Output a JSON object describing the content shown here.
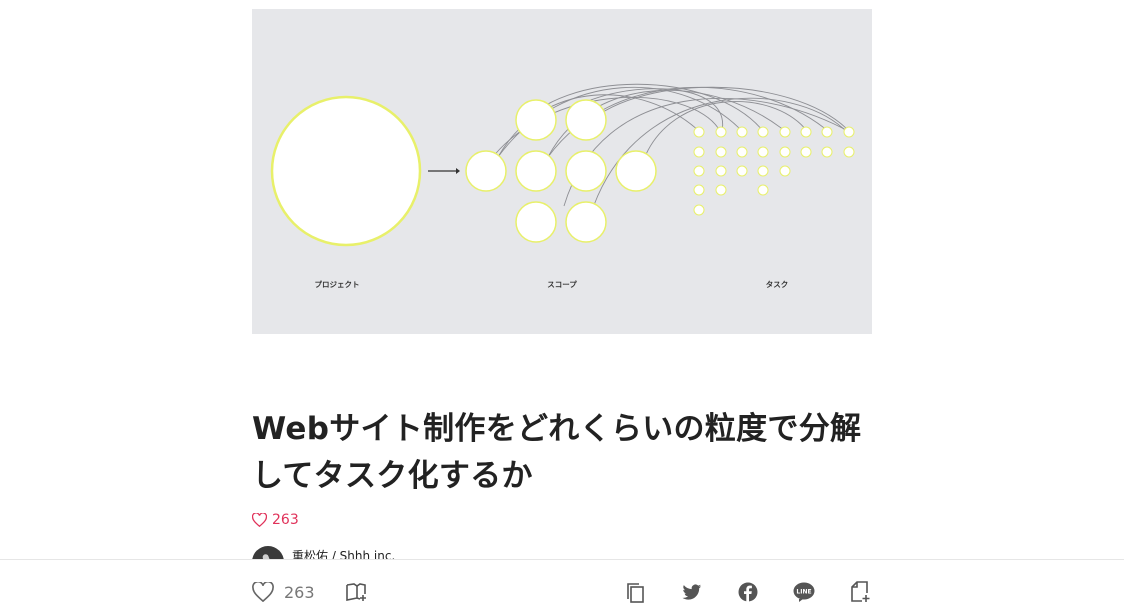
{
  "hero": {
    "label_project": "プロジェクト",
    "label_scope": "スコープ",
    "label_task": "タスク"
  },
  "article": {
    "title": "Webサイト制作をどれくらいの粒度で分解してタスク化するか",
    "like_count": "263"
  },
  "author": {
    "name": "重松佑 / Shhh inc."
  },
  "bottom_bar": {
    "like_count": "263",
    "icons": [
      "heart-icon",
      "magazine-add-icon",
      "copy-icon",
      "twitter-icon",
      "facebook-icon",
      "line-icon",
      "note-add-icon"
    ]
  },
  "colors": {
    "like_red": "#e0325a",
    "hero_bg": "#e6e7ea",
    "circle_glow": "#e8f06a"
  }
}
